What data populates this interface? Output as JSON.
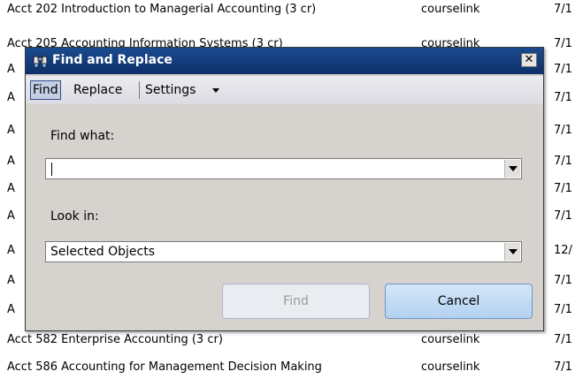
{
  "background_list": {
    "rows": [
      {
        "course": "Acct 202  Introduction to Managerial Accounting (3 cr)",
        "source": "courselink",
        "date": "7/1"
      },
      {
        "course": "Acct 205  Accounting Information Systems (3 cr)",
        "source": "courselink",
        "date": "7/1"
      },
      {
        "course": "A",
        "source": "",
        "date": "7/1"
      },
      {
        "course": "A",
        "source": "",
        "date": "7/1"
      },
      {
        "course": "A",
        "source": "",
        "date": "7/1"
      },
      {
        "course": "A",
        "source": "",
        "date": "7/1"
      },
      {
        "course": "A",
        "source": "",
        "date": "7/1"
      },
      {
        "course": "A",
        "source": "",
        "date": "7/1"
      },
      {
        "course": "A",
        "source": "",
        "date": "12/"
      },
      {
        "course": "A",
        "source": "",
        "date": "7/1"
      },
      {
        "course": "A",
        "source": "",
        "date": "7/1"
      },
      {
        "course": "Acct 582  Enterprise Accounting (3 cr)",
        "source": "courselink",
        "date": "7/1"
      },
      {
        "course": "Acct 586  Accounting for Management Decision Making",
        "source": "courselink",
        "date": "7/1"
      }
    ]
  },
  "dialog": {
    "title": "Find and Replace",
    "close_glyph": "✕",
    "title_icon": "binoculars-icon",
    "tabs": [
      {
        "label": "Find",
        "active": true
      },
      {
        "label": "Replace",
        "active": false
      },
      {
        "label": "Settings",
        "active": false
      }
    ],
    "find_what": {
      "label": "Find what:",
      "value": ""
    },
    "look_in": {
      "label": "Look in:",
      "value": "Selected Objects"
    },
    "buttons": {
      "find": "Find",
      "cancel": "Cancel"
    },
    "colors": {
      "titlebar": "#0d2f6a",
      "dialog_bg": "#d6d3ce",
      "cancel_button": "#b3d2f0"
    }
  }
}
